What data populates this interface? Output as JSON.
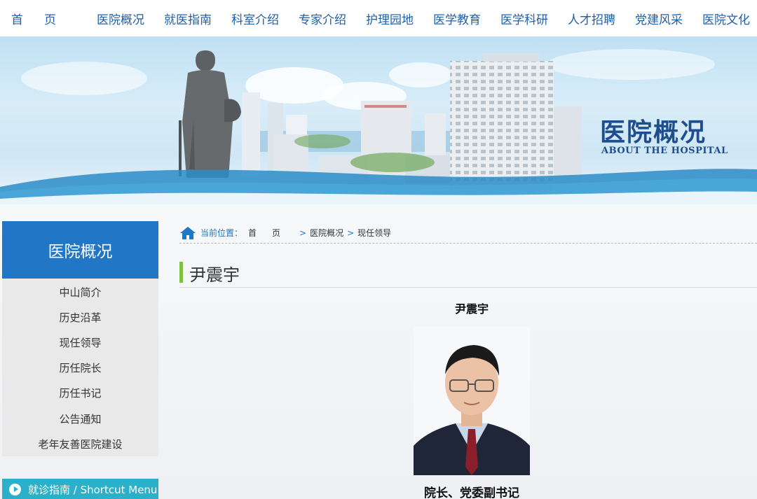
{
  "nav": {
    "items": [
      "首页",
      "医院概况",
      "就医指南",
      "科室介绍",
      "专家介绍",
      "护理园地",
      "医学教育",
      "医学科研",
      "人才招聘",
      "党建风采",
      "医院文化"
    ]
  },
  "banner": {
    "title": "医院概况",
    "subtitle": "ABOUT THE HOSPITAL"
  },
  "sidebar": {
    "heading": "医院概况",
    "items": [
      "中山简介",
      "历史沿革",
      "现任领导",
      "历任院长",
      "历任书记",
      "公告通知",
      "老年友善医院建设"
    ],
    "shortcut": "就诊指南 / Shortcut Menu"
  },
  "breadcrumb": {
    "label": "当前位置：",
    "path": [
      "首页",
      "医院概况",
      "现任领导"
    ]
  },
  "page": {
    "heading": "尹震宇"
  },
  "article": {
    "name": "尹震宇",
    "title": "院长、党委副书记"
  },
  "colors": {
    "brand_blue": "#2176c5",
    "nav_blue": "#1f5fa8",
    "accent_green": "#7bbf3a",
    "shortcut_teal": "#2bb0c9"
  }
}
